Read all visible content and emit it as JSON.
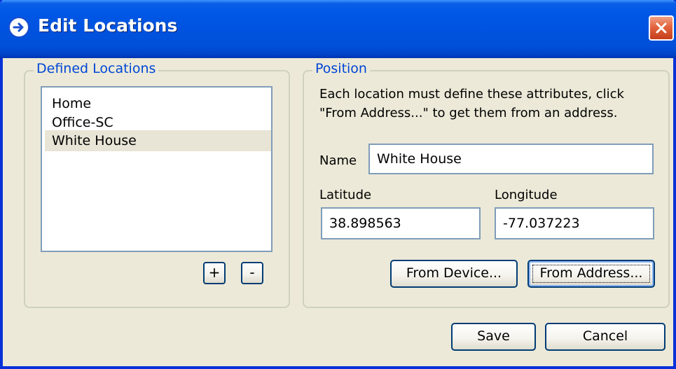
{
  "window": {
    "title": "Edit Locations"
  },
  "defined_locations": {
    "label": "Defined Locations",
    "items": [
      "Home",
      "Office-SC",
      "White House"
    ],
    "selected": "White House",
    "add_label": "+",
    "remove_label": "-"
  },
  "position": {
    "label": "Position",
    "instructions_line1": "Each location must define these attributes, click",
    "instructions_line2": "\"From Address...\" to get them from an address.",
    "name_label": "Name",
    "name_value": "White House",
    "latitude_label": "Latitude",
    "latitude_value": "38.898563",
    "longitude_label": "Longitude",
    "longitude_value": "-77.037223",
    "from_device_label": "From Device...",
    "from_address_label": "From Address..."
  },
  "footer": {
    "save_label": "Save",
    "cancel_label": "Cancel"
  },
  "icons": {
    "title": "arrow-right-circle-icon",
    "close": "close-icon"
  },
  "colors": {
    "titlebar": "#0054e3",
    "group_label": "#0046d5",
    "close_button": "#e2643e",
    "dialog_background": "#ece9d8"
  }
}
